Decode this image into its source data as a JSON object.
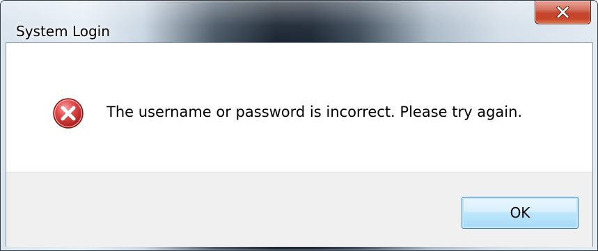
{
  "window": {
    "title": "System Login"
  },
  "title_bar": {
    "close_icon": "close-x-icon"
  },
  "dialog": {
    "icon": "error-icon",
    "message": "The username or password is incorrect. Please try again.",
    "ok_label": "OK"
  },
  "colors": {
    "error_red": "#d93838",
    "close_button_red": "#c4432b",
    "button_area_bg": "#f0f0f0",
    "ok_button_border": "#3c7fb1"
  }
}
